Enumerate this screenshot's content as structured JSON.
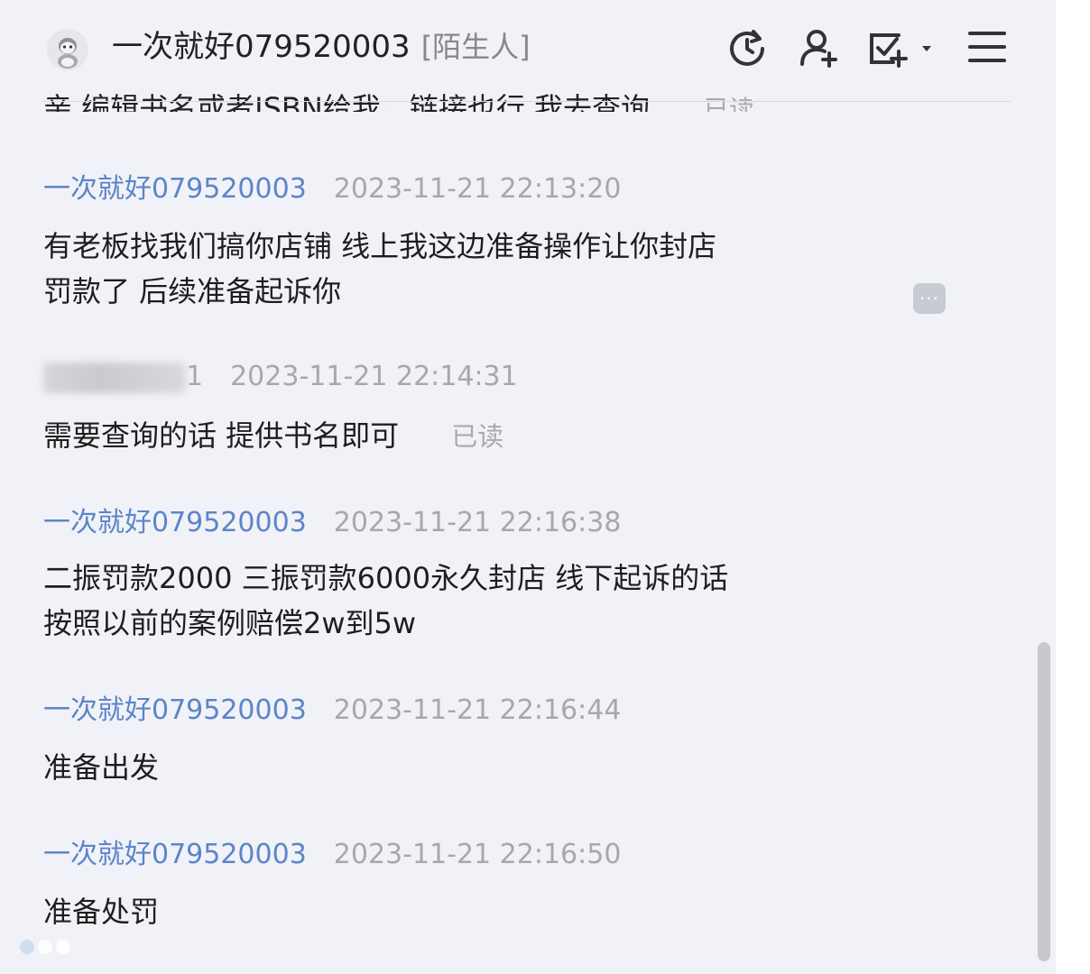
{
  "header": {
    "title": "一次就好079520003",
    "relation_tag": "[陌生人]",
    "icons": [
      "refresh-icon",
      "add-user-icon",
      "task-check-icon",
      "menu-icon"
    ]
  },
  "messages": {
    "cutoff_text": "亲 编辑书名或者ISBN给我，链接也行 我去查询",
    "cutoff_read": "已读",
    "items": [
      {
        "sender": "一次就好079520003",
        "time": "2023-11-21 22:13:20",
        "lines": [
          "有老板找我们搞你店铺 线上我这边准备操作让你封店",
          "罚款了 后续准备起诉你"
        ]
      },
      {
        "sender_suffix": "1",
        "time": "2023-11-21 22:14:31",
        "lines": [
          "需要查询的话 提供书名即可"
        ],
        "read_status": "已读"
      },
      {
        "sender": "一次就好079520003",
        "time": "2023-11-21 22:16:38",
        "lines": [
          "二振罚款2000 三振罚款6000永久封店 线下起诉的话",
          "按照以前的案例赔偿2w到5w"
        ]
      },
      {
        "sender": "一次就好079520003",
        "time": "2023-11-21 22:16:44",
        "lines": [
          "准备出发"
        ]
      },
      {
        "sender": "一次就好079520003",
        "time": "2023-11-21 22:16:50",
        "lines": [
          "准备处罚"
        ]
      }
    ]
  },
  "more_button_label": "···",
  "colors": {
    "panel_bg": "#f1f2f7",
    "sender_name": "#5b85c9",
    "timestamp": "#a6a8ae",
    "text": "#1e1e1e"
  }
}
